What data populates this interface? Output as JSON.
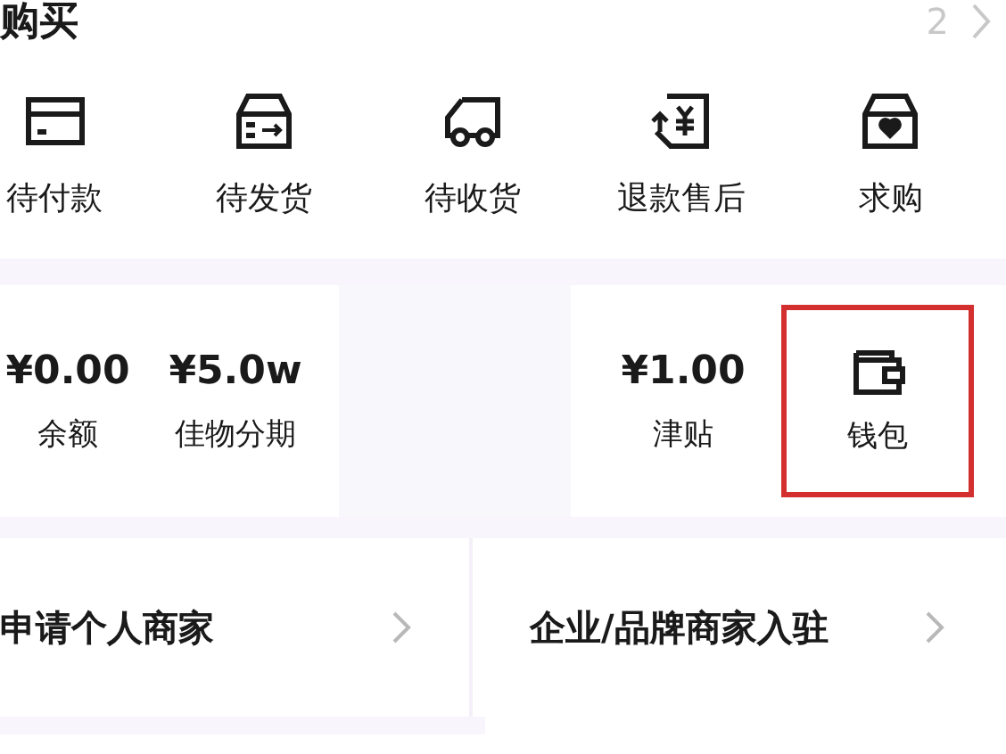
{
  "section": {
    "title": "购买",
    "count": "2"
  },
  "orders": [
    {
      "label": "待付款",
      "kind": "card"
    },
    {
      "label": "待发货",
      "kind": "box"
    },
    {
      "label": "待收货",
      "kind": "truck"
    },
    {
      "label": "退款售后",
      "kind": "refund"
    },
    {
      "label": "求购",
      "kind": "wish"
    }
  ],
  "wallet": [
    {
      "value": "¥0.00",
      "label": "余额",
      "kind": "amount",
      "highlighted": false
    },
    {
      "value": "¥5.0w",
      "label": "佳物分期",
      "kind": "amount",
      "highlighted": false
    },
    {
      "kind": "blank"
    },
    {
      "value": "¥1.00",
      "label": "津贴",
      "kind": "amount",
      "highlighted": false
    },
    {
      "label": "钱包",
      "kind": "wallet",
      "highlighted": true
    }
  ],
  "merchant": [
    {
      "label": "申请个人商家"
    },
    {
      "label": "企业/品牌商家入驻"
    }
  ]
}
